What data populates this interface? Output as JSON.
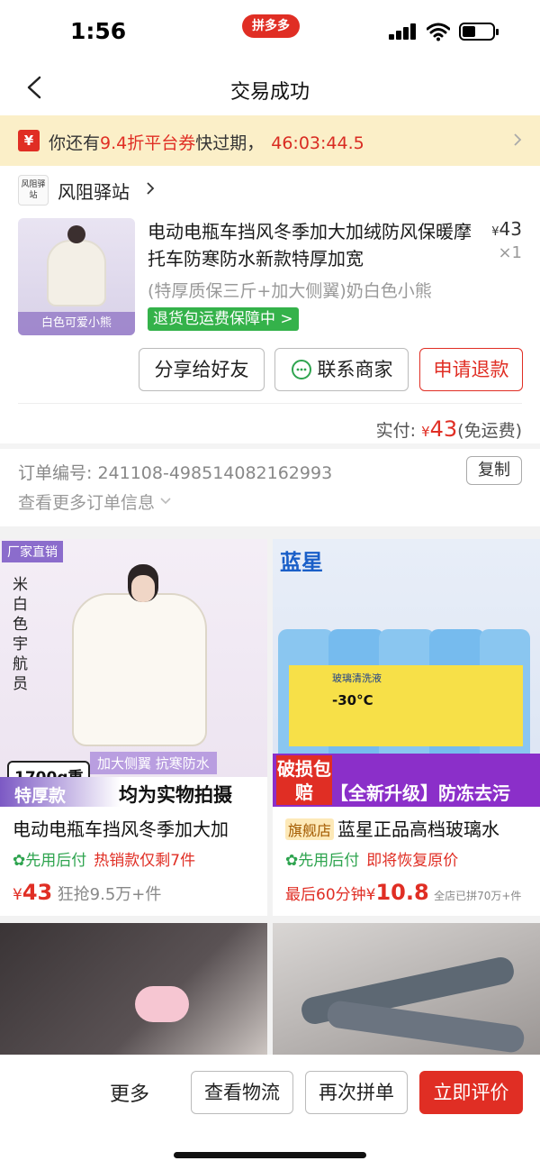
{
  "status": {
    "time": "1:56",
    "app_badge": "拼多多"
  },
  "nav": {
    "title": "交易成功"
  },
  "banner": {
    "icon_char": "¥",
    "text_prefix": "你还有",
    "text_highlight": "9.4折平台券",
    "text_suffix": "快过期，",
    "countdown": "46:03:44.5"
  },
  "store": {
    "logo_text": "风阻驿站",
    "name": "风阻驿站"
  },
  "product": {
    "image_caption": "白色可爱小熊",
    "title": "电动电瓶车挡风冬季加大加绒防风保暖摩托车防寒防水新款特厚加宽",
    "currency": "¥",
    "price": "43",
    "qty": "×1",
    "spec": "(特厚质保三斤+加大侧翼)奶白色小熊",
    "badge": "退货包运费保障中 >"
  },
  "actions": {
    "share": "分享给好友",
    "contact": "联系商家",
    "refund": "申请退款"
  },
  "payment": {
    "label": "实付:",
    "currency": "¥",
    "amount": "43",
    "note": "(免运费)"
  },
  "order": {
    "label": "订单编号:",
    "number": "241108-498514082162993",
    "copy": "复制",
    "more": "查看更多订单信息"
  },
  "recommend": [
    {
      "corner_tag": "厂家直销",
      "side_text": "米白色宇航员",
      "tag_line": "加大侧翼 抗寒防水",
      "weight_badge": "1700g重",
      "weight_sub": "特厚款",
      "photo_note": "均为实物拍摄",
      "title": "电动电瓶车挡风冬季加大加",
      "tag_green": "先用后付",
      "tag_red": "热销款仅剩7件",
      "currency": "¥",
      "price": "43",
      "sales": "狂抢9.5万+件"
    },
    {
      "brand": "蓝星",
      "bottle_label": "玻璃清洗液",
      "bottle_temp": "-30°C",
      "promo_left": "破损包赔",
      "promo_right": "【全新升级】防冻去污",
      "flag": "旗舰店",
      "title": "蓝星正品高档玻璃水",
      "tag_green": "先用后付",
      "tag_red": "即将恢复原价",
      "countdown_text": "最后60分钟",
      "currency": "¥",
      "price": "10.8",
      "sales": "全店已拼70万+件"
    }
  ],
  "bottom": {
    "more": "更多",
    "logistics": "查看物流",
    "reorder": "再次拼单",
    "review": "立即评价"
  },
  "colors": {
    "accent": "#e02e24",
    "green": "#34b24a",
    "banner_bg": "#fbefc8"
  }
}
